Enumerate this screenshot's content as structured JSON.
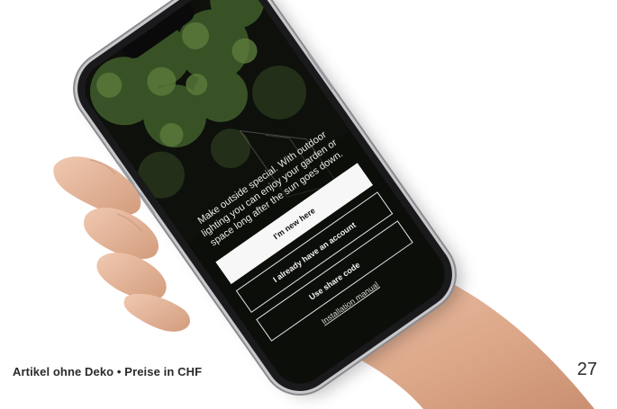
{
  "app_screen": {
    "tagline": "Make outside special. With outdoor lighting you can enjoy your garden or space long after the sun goes down.",
    "buttons": {
      "new_here": "I'm new here",
      "have_account": "I already have an account",
      "share_code": "Use share code"
    },
    "manual_link": "Installation manual"
  },
  "caption": {
    "text": "Artikel ohne Deko • Preise in CHF",
    "page_number": "27"
  },
  "colors": {
    "background": "#ffffff",
    "phone_body": "#1a1a1c",
    "screen_dark": "#0e100c",
    "foliage": "#3e5a2a",
    "skin": "#e2b49a",
    "button_light": "#f7f7f7"
  },
  "icons": [
    "phone-notch-icon"
  ]
}
